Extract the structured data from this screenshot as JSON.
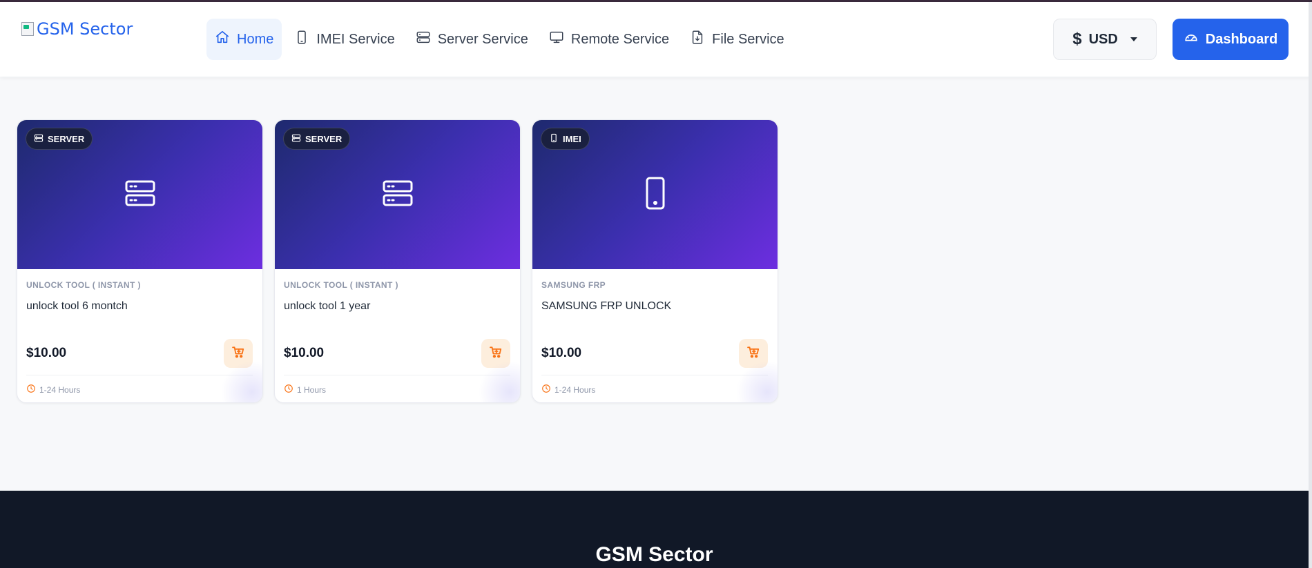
{
  "header": {
    "logo_alt": "GSM Sector",
    "nav": [
      {
        "label": "Home",
        "icon": "home-icon",
        "active": true
      },
      {
        "label": "IMEI Service",
        "icon": "phone-icon",
        "active": false
      },
      {
        "label": "Server Service",
        "icon": "server-icon",
        "active": false
      },
      {
        "label": "Remote Service",
        "icon": "monitor-icon",
        "active": false
      },
      {
        "label": "File Service",
        "icon": "file-download-icon",
        "active": false
      }
    ],
    "currency": {
      "symbol": "$",
      "label": "USD"
    },
    "dashboard_label": "Dashboard"
  },
  "products": [
    {
      "badge": "SERVER",
      "badge_icon": "server-icon",
      "category": "UNLOCK TOOL ( INSTANT )",
      "title": "unlock tool 6 montch",
      "price": "$10.00",
      "time": "1-24 Hours"
    },
    {
      "badge": "SERVER",
      "badge_icon": "server-icon",
      "category": "UNLOCK TOOL ( INSTANT )",
      "title": "unlock tool 1 year",
      "price": "$10.00",
      "time": "1 Hours"
    },
    {
      "badge": "IMEI",
      "badge_icon": "phone-icon",
      "category": "SAMSUNG FRP",
      "title": "SAMSUNG FRP UNLOCK",
      "price": "$10.00",
      "time": "1-24 Hours"
    }
  ],
  "footer": {
    "title": "GSM Sector"
  },
  "colors": {
    "accent": "#2563eb",
    "hero_gradient": [
      "#1e2a6e",
      "#6d2ee0"
    ],
    "cart": "#f97316",
    "footer_bg": "#111827"
  }
}
